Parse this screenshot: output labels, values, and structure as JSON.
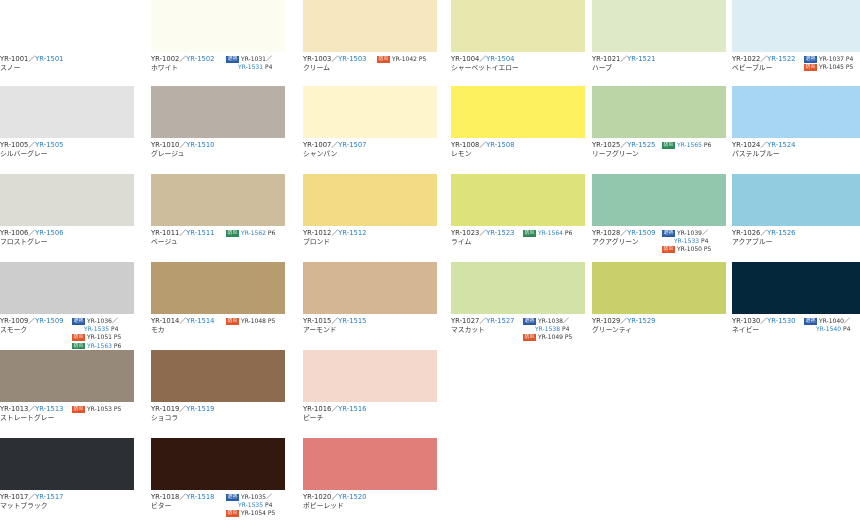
{
  "swatches": [
    {
      "col": 0,
      "row": 0,
      "color": "#ffffff",
      "code": "YR-1001",
      "alt": "YR-1501",
      "name": "スノー",
      "tags": []
    },
    {
      "col": 1,
      "row": 0,
      "color": "#fdfcf1",
      "code": "YR-1002",
      "alt": "YR-1502",
      "name": "ホワイト",
      "tags": [
        {
          "label": "遮熱",
          "style": "b",
          "lines": [
            {
              "t": "YR-1031／",
              "p": ""
            },
            {
              "t": "YR-1531",
              "alt": true,
              "p": "P4"
            }
          ]
        }
      ]
    },
    {
      "col": 2,
      "row": 0,
      "color": "#f7e7bf",
      "code": "YR-1003",
      "alt": "YR-1503",
      "name": "クリーム",
      "tags": [
        {
          "label": "防炎",
          "style": "r",
          "lines": [
            {
              "t": "YR-1042",
              "p": "P5"
            }
          ]
        }
      ]
    },
    {
      "col": 3,
      "row": 0,
      "color": "#e6e8ad",
      "code": "YR-1004",
      "alt": "YR-1504",
      "name": "シャーベットイエロー",
      "tags": []
    },
    {
      "col": 4,
      "row": 0,
      "color": "#dde9c7",
      "code": "YR-1021",
      "alt": "YR-1521",
      "name": "ハーブ",
      "tags": []
    },
    {
      "col": 5,
      "row": 0,
      "color": "#dcedf3",
      "code": "YR-1022",
      "alt": "YR-1522",
      "name": "ベビーブルー",
      "tags": [
        {
          "label": "遮熱",
          "style": "b",
          "lines": [
            {
              "t": "YR-1037",
              "p": "P4"
            }
          ]
        },
        {
          "label": "防炎",
          "style": "r",
          "lines": [
            {
              "t": "YR-1045",
              "p": "P5"
            }
          ]
        }
      ]
    },
    {
      "col": 0,
      "row": 1,
      "color": "#e3e3e3",
      "code": "YR-1005",
      "alt": "YR-1505",
      "name": "シルバーグレー",
      "tags": []
    },
    {
      "col": 1,
      "row": 1,
      "color": "#b8b0a6",
      "code": "YR-1010",
      "alt": "YR-1510",
      "name": "グレージュ",
      "tags": []
    },
    {
      "col": 2,
      "row": 1,
      "color": "#fef5cc",
      "code": "YR-1007",
      "alt": "YR-1507",
      "name": "シャンパン",
      "tags": []
    },
    {
      "col": 3,
      "row": 1,
      "color": "#fdf15f",
      "code": "YR-1008",
      "alt": "YR-1508",
      "name": "レモン",
      "tags": []
    },
    {
      "col": 4,
      "row": 1,
      "color": "#bcd5a7",
      "code": "YR-1025",
      "alt": "YR-1525",
      "name": "リーフグリーン",
      "tags": [
        {
          "label": "防炎",
          "style": "g",
          "lines": [
            {
              "t": "YR-1565",
              "alt": true,
              "p": "P6"
            }
          ]
        }
      ]
    },
    {
      "col": 5,
      "row": 1,
      "color": "#a7d6f3",
      "code": "YR-1024",
      "alt": "YR-1524",
      "name": "パステルブルー",
      "tags": []
    },
    {
      "col": 0,
      "row": 2,
      "color": "#dcdcd3",
      "code": "YR-1006",
      "alt": "YR-1506",
      "name": "フロストグレー",
      "tags": []
    },
    {
      "col": 1,
      "row": 2,
      "color": "#cdbd9c",
      "code": "YR-1011",
      "alt": "YR-1511",
      "name": "ベージュ",
      "tags": [
        {
          "label": "防炎",
          "style": "g",
          "lines": [
            {
              "t": "YR-1562",
              "alt": true,
              "p": "P6"
            }
          ]
        }
      ]
    },
    {
      "col": 2,
      "row": 2,
      "color": "#f3db86",
      "code": "YR-1012",
      "alt": "YR-1512",
      "name": "ブロンド",
      "tags": []
    },
    {
      "col": 3,
      "row": 2,
      "color": "#dde27a",
      "code": "YR-1023",
      "alt": "YR-1523",
      "name": "ライム",
      "tags": [
        {
          "label": "防炎",
          "style": "g",
          "lines": [
            {
              "t": "YR-1564",
              "alt": true,
              "p": "P6"
            }
          ]
        }
      ]
    },
    {
      "col": 4,
      "row": 2,
      "color": "#92c6ad",
      "code": "YR-1028",
      "alt": "YR-1509",
      "name": "アクアグリーン",
      "tags": [
        {
          "label": "遮熱",
          "style": "b",
          "lines": [
            {
              "t": "YR-1039／",
              "p": ""
            },
            {
              "t": "YR-1533",
              "alt": true,
              "p": "P4"
            }
          ]
        },
        {
          "label": "防炎",
          "style": "r",
          "lines": [
            {
              "t": "YR-1050",
              "p": "P5"
            }
          ]
        }
      ]
    },
    {
      "col": 5,
      "row": 2,
      "color": "#90cde0",
      "code": "YR-1026",
      "alt": "YR-1526",
      "name": "アクアブルー",
      "tags": []
    },
    {
      "col": 0,
      "row": 3,
      "color": "#cdcdcd",
      "code": "YR-1009",
      "alt": "YR-1509",
      "name": "スモーク",
      "tags": [
        {
          "label": "遮熱",
          "style": "b",
          "lines": [
            {
              "t": "YR-1036／",
              "p": ""
            },
            {
              "t": "YR-1535",
              "alt": true,
              "p": "P4"
            }
          ]
        },
        {
          "label": "防炎",
          "style": "r",
          "lines": [
            {
              "t": "YR-1051",
              "p": "P5"
            }
          ]
        },
        {
          "label": "防炎",
          "style": "g",
          "lines": [
            {
              "t": "YR-1563",
              "alt": true,
              "p": "P6"
            }
          ]
        }
      ]
    },
    {
      "col": 1,
      "row": 3,
      "color": "#b69c6f",
      "code": "YR-1014",
      "alt": "YR-1514",
      "name": "モカ",
      "tags": [
        {
          "label": "防炎",
          "style": "r",
          "lines": [
            {
              "t": "YR-1048",
              "p": "P5"
            }
          ]
        }
      ]
    },
    {
      "col": 2,
      "row": 3,
      "color": "#d4b792",
      "code": "YR-1015",
      "alt": "YR-1515",
      "name": "アーモンド",
      "tags": []
    },
    {
      "col": 3,
      "row": 3,
      "color": "#d3e2a7",
      "code": "YR-1027",
      "alt": "YR-1527",
      "name": "マスカット",
      "tags": [
        {
          "label": "遮熱",
          "style": "b",
          "lines": [
            {
              "t": "YR-1038／",
              "p": ""
            },
            {
              "t": "YR-1538",
              "alt": true,
              "p": "P4"
            }
          ]
        },
        {
          "label": "防炎",
          "style": "r",
          "lines": [
            {
              "t": "YR-1049",
              "p": "P5"
            }
          ]
        }
      ]
    },
    {
      "col": 4,
      "row": 3,
      "color": "#c8d06c",
      "code": "YR-1029",
      "alt": "YR-1529",
      "name": "グリーンティ",
      "tags": []
    },
    {
      "col": 5,
      "row": 3,
      "color": "#04273b",
      "code": "YR-1030",
      "alt": "YR-1530",
      "name": "ネイビー",
      "tags": [
        {
          "label": "遮熱",
          "style": "b",
          "lines": [
            {
              "t": "YR-1040／",
              "p": ""
            },
            {
              "t": "YR-1540",
              "alt": true,
              "p": "P4"
            }
          ]
        }
      ]
    },
    {
      "col": 0,
      "row": 4,
      "color": "#96897a",
      "code": "YR-1013",
      "alt": "YR-1513",
      "name": "ストレートグレー",
      "tags": [
        {
          "label": "防炎",
          "style": "r",
          "lines": [
            {
              "t": "YR-1053",
              "p": "P5"
            }
          ]
        }
      ]
    },
    {
      "col": 1,
      "row": 4,
      "color": "#8c6b4f",
      "code": "YR-1019",
      "alt": "YR-1519",
      "name": "ショコラ",
      "tags": []
    },
    {
      "col": 2,
      "row": 4,
      "color": "#f5d8cc",
      "code": "YR-1016",
      "alt": "YR-1516",
      "name": "ピーチ",
      "tags": []
    },
    {
      "col": 0,
      "row": 5,
      "color": "#2c2f33",
      "code": "YR-1017",
      "alt": "YR-1517",
      "name": "マットブラック",
      "tags": []
    },
    {
      "col": 1,
      "row": 5,
      "color": "#33180f",
      "code": "YR-1018",
      "alt": "YR-1518",
      "name": "ビター",
      "tags": [
        {
          "label": "遮熱",
          "style": "b",
          "lines": [
            {
              "t": "YR-1035／",
              "p": ""
            },
            {
              "t": "YR-1535",
              "alt": true,
              "p": "P4"
            }
          ]
        },
        {
          "label": "防炎",
          "style": "r",
          "lines": [
            {
              "t": "YR-1054",
              "p": "P5"
            }
          ]
        }
      ]
    },
    {
      "col": 2,
      "row": 5,
      "color": "#e07f7a",
      "code": "YR-1020",
      "alt": "YR-1520",
      "name": "ポピーレッド",
      "tags": []
    }
  ]
}
